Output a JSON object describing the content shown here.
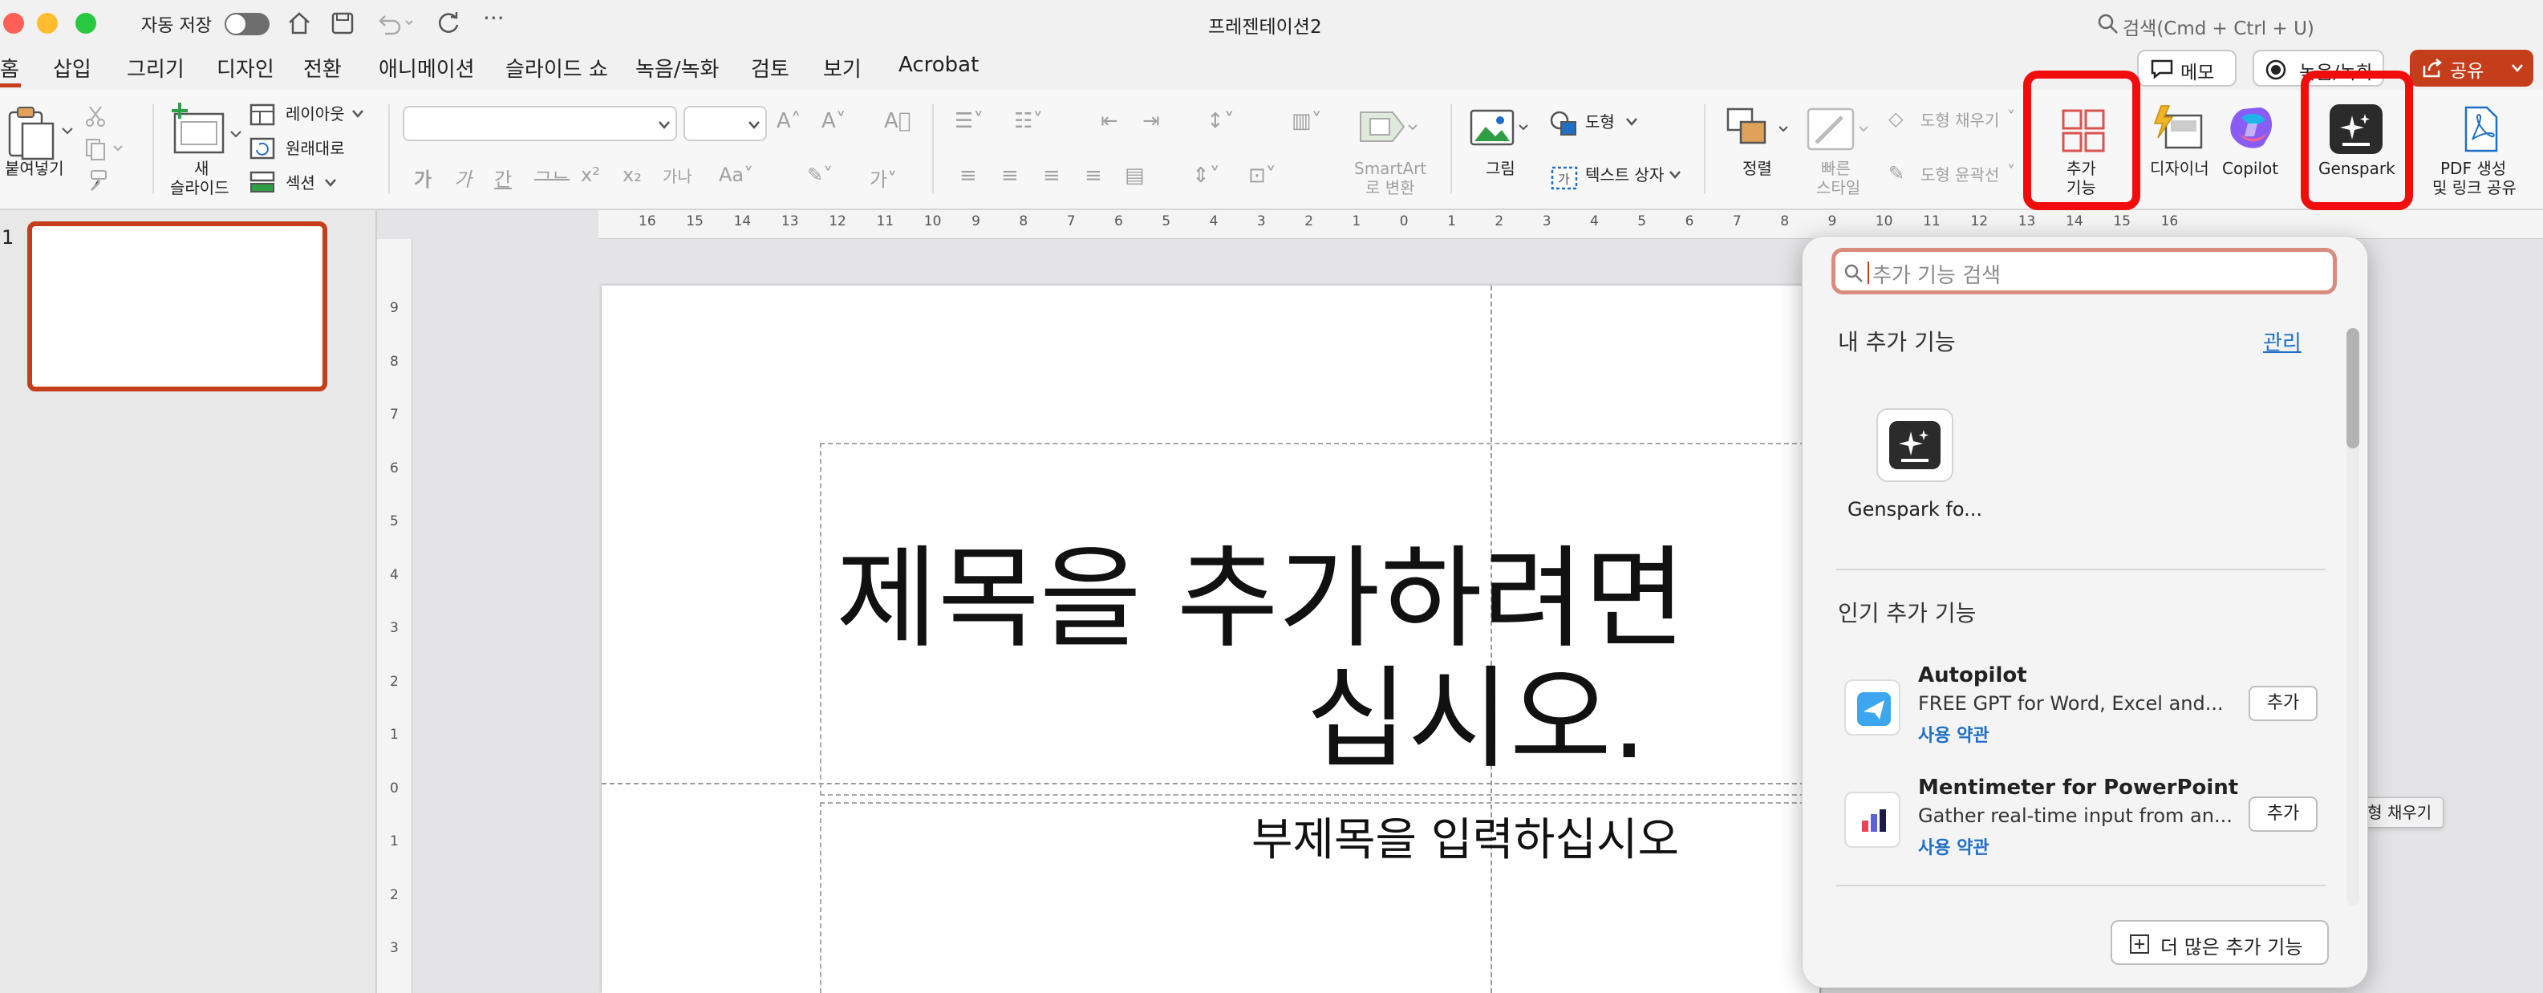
{
  "window": {
    "autosave_label": "자동 저장",
    "document_title": "프레젠테이션2",
    "search_placeholder": "검색(Cmd + Ctrl + U)"
  },
  "menu_tabs": [
    "홈",
    "삽입",
    "그리기",
    "디자인",
    "전환",
    "애니메이션",
    "슬라이드 쇼",
    "녹음/녹화",
    "검토",
    "보기",
    "Acrobat"
  ],
  "header_buttons": {
    "memo": "메모",
    "record": "녹음/녹화",
    "share": "공유"
  },
  "ribbon": {
    "paste": "붙여넣기",
    "new_slide_1": "새",
    "new_slide_2": "슬라이드",
    "layout": "레이아웃",
    "reset": "원래대로",
    "section": "섹션",
    "smartart_1": "SmartArt",
    "smartart_2": "로 변환",
    "picture": "그림",
    "shape": "도형",
    "textbox": "텍스트 상자",
    "arrange": "정렬",
    "quick_style_1": "빠른",
    "quick_style_2": "스타일",
    "shape_fill": "도형 채우기",
    "shape_outline": "도형 윤곽선",
    "addins_1": "추가",
    "addins_2": "기능",
    "designer": "디자이너",
    "copilot": "Copilot",
    "genspark": "Genspark",
    "pdf_1": "PDF 생성",
    "pdf_2": "및 링크 공유"
  },
  "ruler": {
    "h_ticks": [
      "16",
      "15",
      "14",
      "13",
      "12",
      "11",
      "10",
      "9",
      "8",
      "7",
      "6",
      "5",
      "4",
      "3",
      "2",
      "1",
      "0",
      "1",
      "2",
      "3",
      "4",
      "5",
      "6",
      "7",
      "8",
      "9",
      "10",
      "11",
      "12",
      "13",
      "14",
      "15",
      "16"
    ],
    "v_ticks": [
      "9",
      "8",
      "7",
      "6",
      "5",
      "4",
      "3",
      "2",
      "1",
      "0",
      "1",
      "2",
      "3"
    ]
  },
  "thumbnail_number": "1",
  "slide": {
    "title_line1": "제목을 추가하려면",
    "title_line2": "십시오.",
    "subtitle": "부제목을 입력하십시오"
  },
  "addins_panel": {
    "search_placeholder": "추가 기능 검색",
    "my_addins_heading": "내 추가 기능",
    "manage_link": "관리",
    "my_addins": [
      {
        "name": "Genspark fo..."
      }
    ],
    "popular_heading": "인기 추가 기능",
    "popular": [
      {
        "name": "Autopilot",
        "desc": "FREE GPT for Word, Excel and...",
        "terms": "사용 약관",
        "add": "추가"
      },
      {
        "name": "Mentimeter for PowerPoint",
        "desc": "Gather real-time input from an...",
        "terms": "사용 약관",
        "add": "추가"
      }
    ],
    "more_button": "더 많은 추가 기능"
  },
  "tooltip": "도형 채우기",
  "colors": {
    "accent_red": "#c43e1c",
    "highlight_red": "#f20d0d",
    "link_blue": "#1f6fc6",
    "share_bg": "#c43e1c"
  }
}
